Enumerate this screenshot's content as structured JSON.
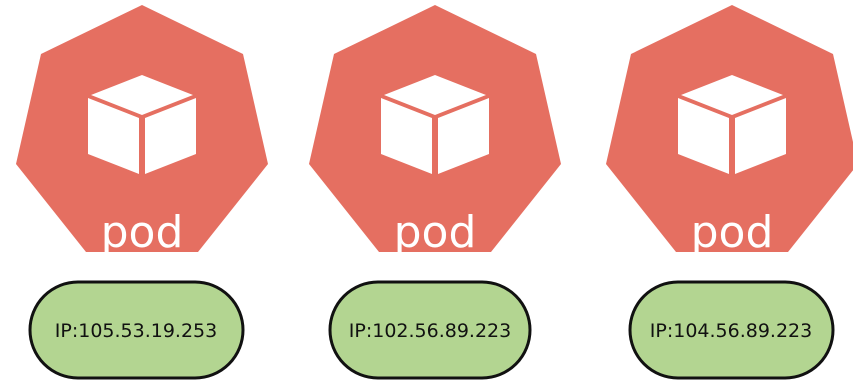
{
  "colors": {
    "pod_fill": "#e56f61",
    "icon_fill": "#ffffff",
    "ip_fill": "#b3d591",
    "ip_stroke": "#111111"
  },
  "pods": [
    {
      "label": "pod",
      "ip": "IP:105.53.19.253"
    },
    {
      "label": "pod",
      "ip": "IP:102.56.89.223"
    },
    {
      "label": "pod",
      "ip": "IP:104.56.89.223"
    }
  ]
}
